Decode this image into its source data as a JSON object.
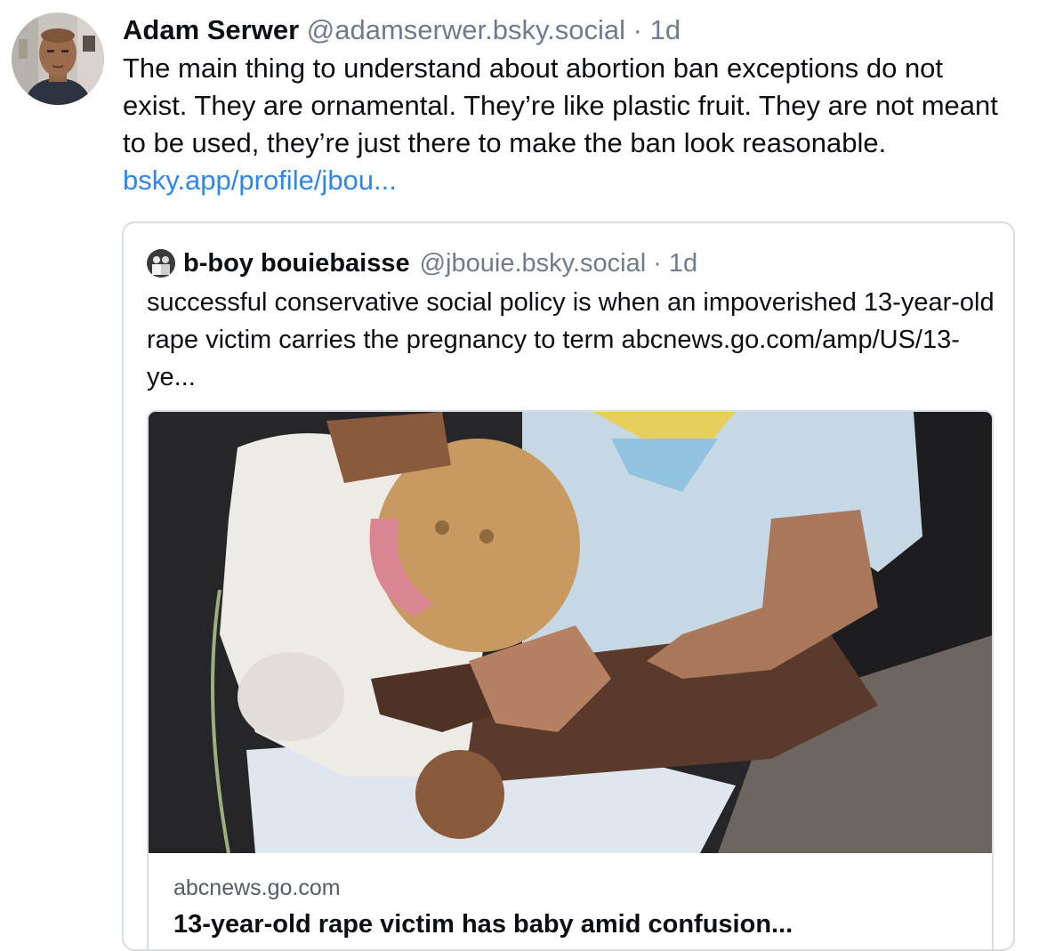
{
  "post": {
    "author": {
      "display_name": "Adam Serwer",
      "handle": "@adamserwer.bsky.social"
    },
    "separator": "·",
    "time": "1d",
    "text_before_link": "The main thing to understand about abortion ban exceptions do not exist. They are ornamental. They’re like plastic fruit. They are not meant to be used, they’re just there to make the ban look reasonable. ",
    "link_text": "bsky.app/profile/jbou...",
    "quote": {
      "author": {
        "display_name": "b-boy bouiebaisse",
        "handle": "@jbouie.bsky.social"
      },
      "separator": "·",
      "time": "1d",
      "text": "successful conservative social policy is when an impoverished 13-year-old rape victim carries the pregnancy to term abcnews.go.com/amp/US/13-ye...",
      "embed": {
        "domain": "abcnews.go.com",
        "title": "13-year-old rape victim has baby amid confusion..."
      }
    }
  },
  "colors": {
    "text": "#0b0f14",
    "muted": "#6f7c8c",
    "link": "#2f86ee",
    "border": "#d7dde3"
  }
}
